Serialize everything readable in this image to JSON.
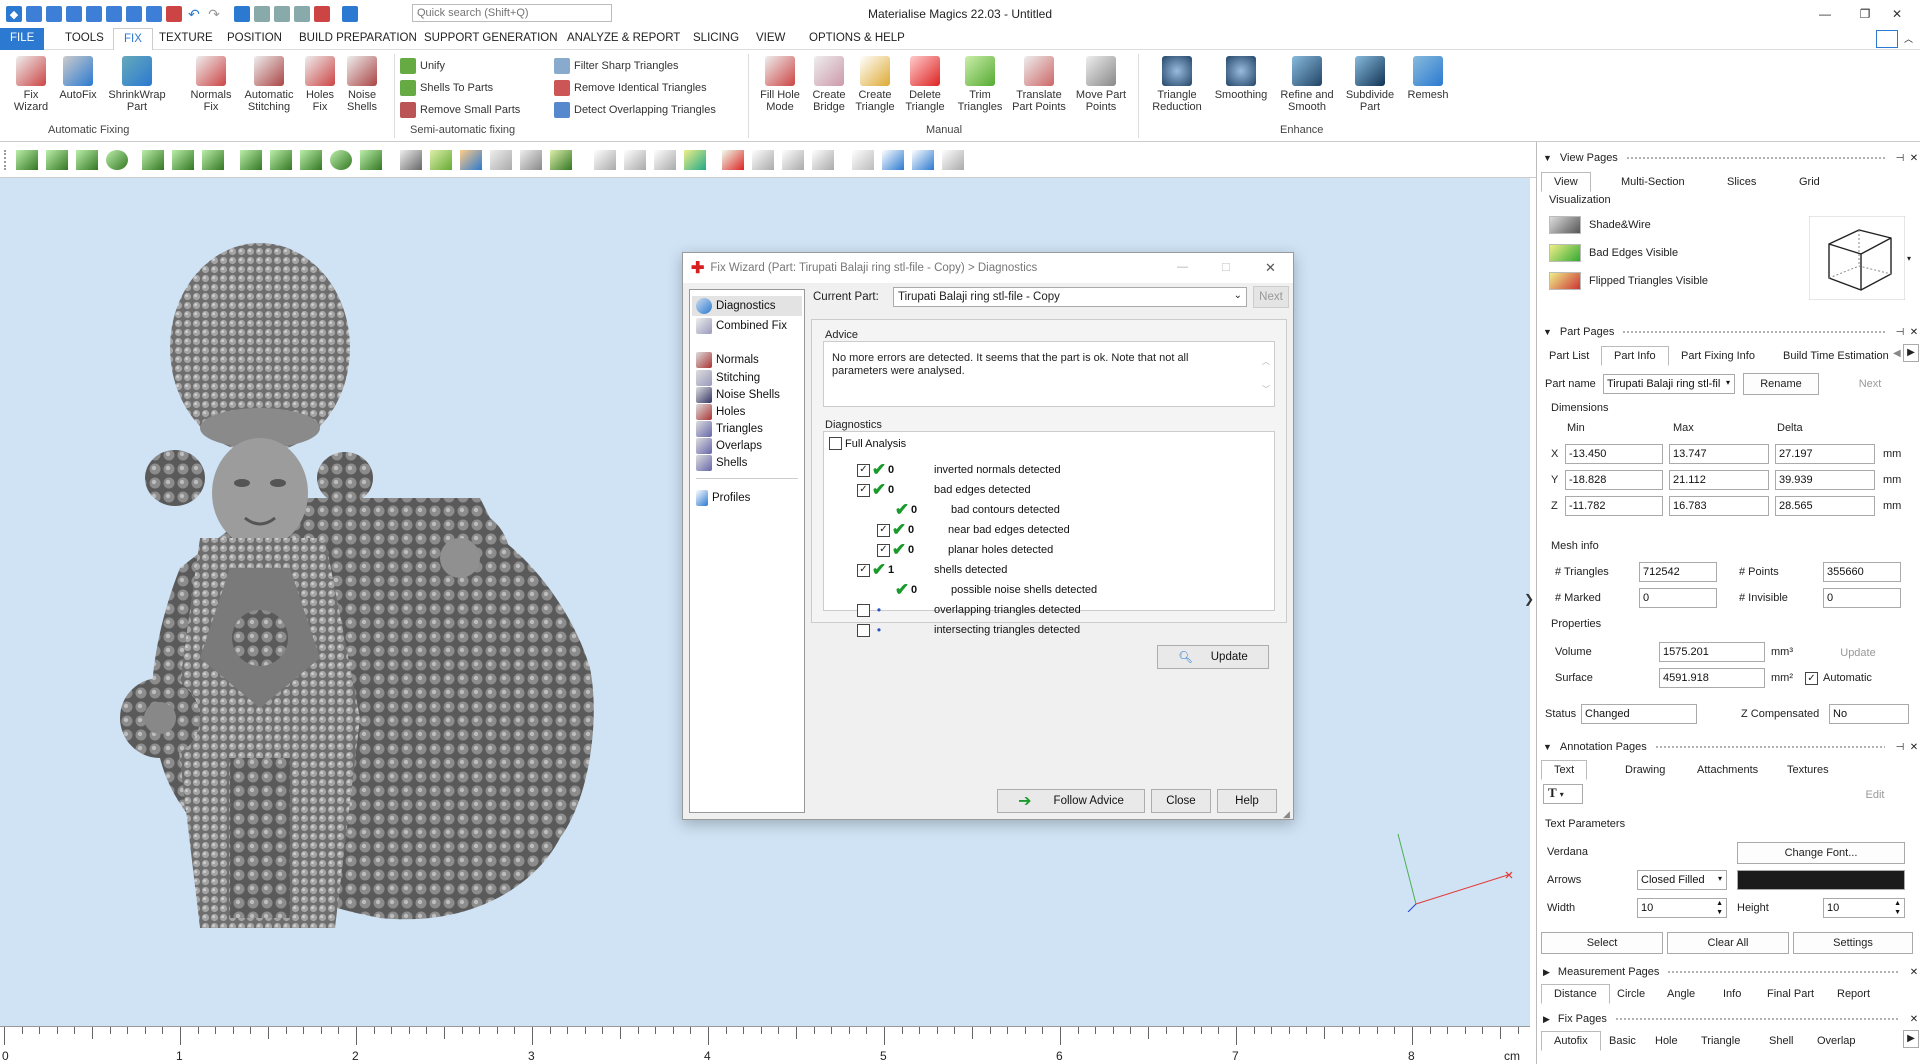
{
  "window": {
    "title": "Materialise Magics 22.03 - Untitled",
    "search_placeholder": "Quick search (Shift+Q)"
  },
  "menu": {
    "tabs": [
      "FILE",
      "TOOLS",
      "FIX",
      "TEXTURE",
      "POSITION",
      "BUILD PREPARATION",
      "SUPPORT GENERATION",
      "ANALYZE & REPORT",
      "SLICING",
      "VIEW",
      "OPTIONS & HELP"
    ],
    "active": "FIX"
  },
  "ribbon": {
    "fix_wizard": "Fix Wizard",
    "autofix": "AutoFix",
    "shrinkwrap": "ShrinkWrap Part",
    "normals_fix": "Normals Fix",
    "auto_stitching": "Automatic Stitching",
    "holes_fix": "Holes Fix",
    "noise_shells": "Noise Shells",
    "group_auto": "Automatic Fixing",
    "unify": "Unify",
    "shells_to_parts": "Shells To Parts",
    "remove_small": "Remove Small Parts",
    "filter_sharp": "Filter Sharp Triangles",
    "remove_identical": "Remove Identical Triangles",
    "detect_overlap": "Detect Overlapping Triangles",
    "group_semi": "Semi-automatic fixing",
    "fill_hole_mode": "Fill Hole Mode",
    "create_bridge": "Create Bridge",
    "create_triangle": "Create Triangle",
    "delete_triangle": "Delete Triangle",
    "trim_triangles": "Trim Triangles",
    "translate_points": "Translate Part Points",
    "move_points": "Move Part Points",
    "group_manual": "Manual",
    "triangle_reduction": "Triangle Reduction",
    "smoothing": "Smoothing",
    "refine_smooth": "Refine and Smooth",
    "subdivide": "Subdivide Part",
    "remesh": "Remesh",
    "group_enhance": "Enhance"
  },
  "dialog": {
    "title": "Fix Wizard (Part: Tirupati Balaji ring stl-file - Copy) > Diagnostics",
    "nav": [
      "Diagnostics",
      "Combined Fix",
      "Normals",
      "Stitching",
      "Noise Shells",
      "Holes",
      "Triangles",
      "Overlaps",
      "Shells",
      "Profiles"
    ],
    "current_part_label": "Current Part:",
    "current_part": "Tirupati Balaji ring stl-file - Copy",
    "next": "Next",
    "advice_label": "Advice",
    "advice_text": "No more errors are detected. It seems that the part is ok. Note that not all parameters were analysed.",
    "diagnostics_label": "Diagnostics",
    "full_analysis": "Full Analysis",
    "rows": [
      {
        "count": "0",
        "label": "inverted normals detected"
      },
      {
        "count": "0",
        "label": "bad edges detected"
      },
      {
        "count": "0",
        "label": "bad contours detected"
      },
      {
        "count": "0",
        "label": "near bad edges detected"
      },
      {
        "count": "0",
        "label": "planar holes detected"
      },
      {
        "count": "1",
        "label": "shells detected"
      },
      {
        "count": "0",
        "label": "possible noise shells detected"
      },
      {
        "count": "",
        "label": "overlapping triangles detected"
      },
      {
        "count": "",
        "label": "intersecting triangles detected"
      }
    ],
    "update": "Update",
    "follow_advice": "Follow Advice",
    "close": "Close",
    "help": "Help"
  },
  "view_pages": {
    "title": "View Pages",
    "tabs": [
      "View",
      "Multi-Section",
      "Slices",
      "Grid"
    ],
    "visualization": "Visualization",
    "items": [
      "Shade&Wire",
      "Bad Edges Visible",
      "Flipped Triangles Visible"
    ]
  },
  "part_pages": {
    "title": "Part Pages",
    "tabs": [
      "Part List",
      "Part Info",
      "Part Fixing Info",
      "Build Time Estimation"
    ],
    "part_name_label": "Part name",
    "part_name": "Tirupati Balaji ring stl-fil",
    "rename": "Rename",
    "next": "Next",
    "dimensions": "Dimensions",
    "cols": [
      "Min",
      "Max",
      "Delta"
    ],
    "x": {
      "label": "X",
      "min": "-13.450",
      "max": "13.747",
      "delta": "27.197"
    },
    "y": {
      "label": "Y",
      "min": "-18.828",
      "max": "21.112",
      "delta": "39.939"
    },
    "z": {
      "label": "Z",
      "min": "-11.782",
      "max": "16.783",
      "delta": "28.565"
    },
    "unit": "mm",
    "mesh_info": "Mesh info",
    "triangles_label": "# Triangles",
    "triangles": "712542",
    "points_label": "# Points",
    "points": "355660",
    "marked_label": "# Marked",
    "marked": "0",
    "invisible_label": "# Invisible",
    "invisible": "0",
    "properties": "Properties",
    "volume_label": "Volume",
    "volume": "1575.201",
    "volume_unit": "mm³",
    "update": "Update",
    "surface_label": "Surface",
    "surface": "4591.918",
    "surface_unit": "mm²",
    "automatic": "Automatic",
    "status_label": "Status",
    "status": "Changed",
    "zcomp_label": "Z Compensated",
    "zcomp": "No"
  },
  "annotation_pages": {
    "title": "Annotation Pages",
    "tabs": [
      "Text",
      "Drawing",
      "Attachments",
      "Textures"
    ],
    "edit": "Edit",
    "text_params": "Text Parameters",
    "font": "Verdana",
    "change_font": "Change Font...",
    "arrows_label": "Arrows",
    "arrows": "Closed Filled",
    "width_label": "Width",
    "width": "10",
    "height_label": "Height",
    "height": "10",
    "select": "Select",
    "clear_all": "Clear All",
    "settings": "Settings"
  },
  "measurement_pages": {
    "title": "Measurement Pages",
    "tabs": [
      "Distance",
      "Circle",
      "Angle",
      "Info",
      "Final Part",
      "Report"
    ]
  },
  "fix_pages": {
    "title": "Fix Pages",
    "tabs": [
      "Autofix",
      "Basic",
      "Hole",
      "Triangle",
      "Shell",
      "Overlap"
    ]
  },
  "ruler": {
    "labels": [
      "0",
      "1",
      "2",
      "3",
      "4",
      "5",
      "6",
      "7",
      "8"
    ],
    "unit": "cm"
  },
  "colors": {
    "accent": "#2b79d0",
    "viewport": "#cfe3f5",
    "check_green": "#1a9a2a"
  }
}
